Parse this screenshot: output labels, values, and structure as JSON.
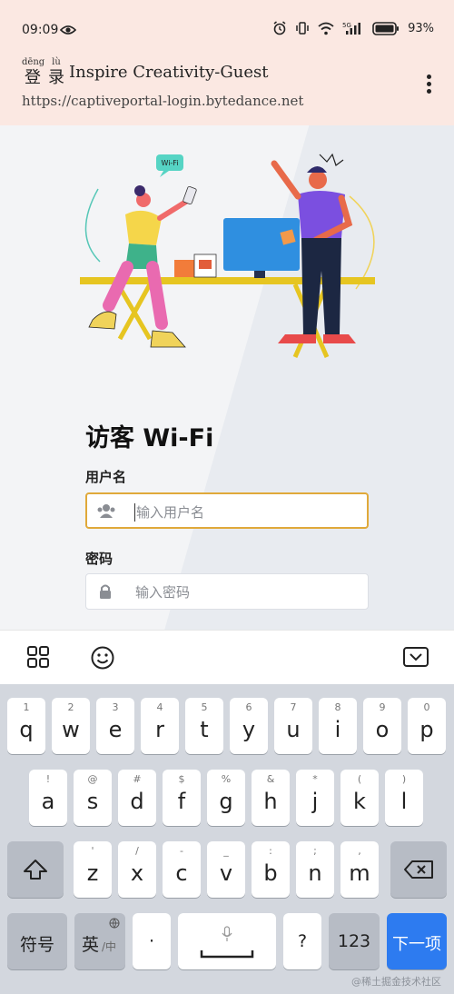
{
  "status_bar": {
    "time": "09:09",
    "battery_percent": "93%",
    "network": "5G"
  },
  "header": {
    "login_pinyin": [
      "dēng",
      "lù"
    ],
    "login_chars": [
      "登",
      "录"
    ],
    "network_name": "Inspire Creativity-Guest",
    "url": "https://captiveportal-login.bytedance.net"
  },
  "illustration": {
    "bubble_text": "Wi-Fi"
  },
  "form": {
    "title": "访客 Wi-Fi",
    "username_label": "用户名",
    "username_placeholder": "输入用户名",
    "password_label": "密码",
    "password_placeholder": "输入密码"
  },
  "keyboard": {
    "row1": [
      {
        "hint": "1",
        "key": "q"
      },
      {
        "hint": "2",
        "key": "w"
      },
      {
        "hint": "3",
        "key": "e"
      },
      {
        "hint": "4",
        "key": "r"
      },
      {
        "hint": "5",
        "key": "t"
      },
      {
        "hint": "6",
        "key": "y"
      },
      {
        "hint": "7",
        "key": "u"
      },
      {
        "hint": "8",
        "key": "i"
      },
      {
        "hint": "9",
        "key": "o"
      },
      {
        "hint": "0",
        "key": "p"
      }
    ],
    "row2": [
      {
        "hint": "!",
        "key": "a"
      },
      {
        "hint": "@",
        "key": "s"
      },
      {
        "hint": "#",
        "key": "d"
      },
      {
        "hint": "$",
        "key": "f"
      },
      {
        "hint": "%",
        "key": "g"
      },
      {
        "hint": "&",
        "key": "h"
      },
      {
        "hint": "*",
        "key": "j"
      },
      {
        "hint": "(",
        "key": "k"
      },
      {
        "hint": ")",
        "key": "l"
      }
    ],
    "row3": [
      {
        "hint": "'",
        "key": "z"
      },
      {
        "hint": "/",
        "key": "x"
      },
      {
        "hint": "-",
        "key": "c"
      },
      {
        "hint": "_",
        "key": "v"
      },
      {
        "hint": ":",
        "key": "b"
      },
      {
        "hint": ";",
        "key": "n"
      },
      {
        "hint": ",",
        "key": "m"
      }
    ],
    "symbols_label": "符号",
    "lang_label_main": "英",
    "lang_label_sub": "/中",
    "dot_key": "·",
    "question_key": "?",
    "numbers_label": "123",
    "next_label": "下一项"
  },
  "watermark": "@稀土掘金技术社区",
  "colors": {
    "accent_blue": "#2d7bf0",
    "focus_border": "#e0a93a",
    "header_bg": "#fbe8e2"
  }
}
